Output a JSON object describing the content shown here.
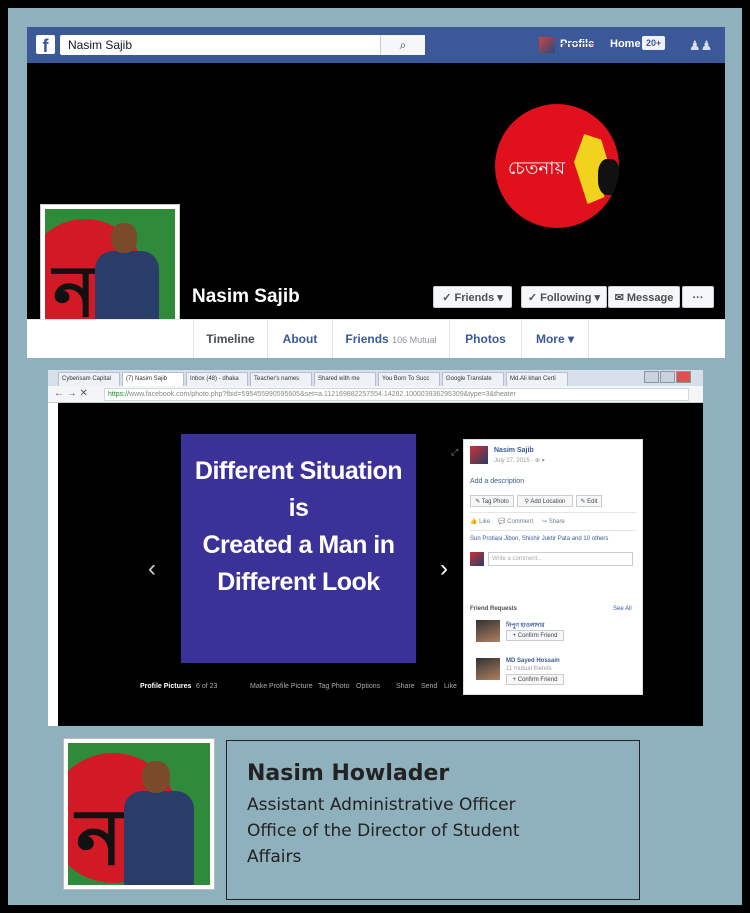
{
  "fb_header": {
    "logo": "f",
    "search_value": "Nasim Sajib",
    "search_icon": "search-icon",
    "user_name": "Profile",
    "home_label": "Home",
    "home_badge": "20+"
  },
  "cover": {
    "logo_text": "চেতনায়"
  },
  "profile": {
    "name": "Nasim Sajib",
    "friends_button": "✓ Friends ▾",
    "following_button": "✓ Following ▾",
    "message_button": "✉ Message",
    "more_button": "···"
  },
  "tabs": {
    "timeline": "Timeline",
    "about": "About",
    "friends": "Friends",
    "friends_mutual": "106 Mutual",
    "photos": "Photos",
    "more": "More ▾"
  },
  "browser": {
    "tabs": [
      "Cyberisam Capital",
      "(7) Nasim Sajib",
      "Inbox (48) - dhaka",
      "Teacher's names",
      "Shared with me",
      "You Born To Succ",
      "Google Translate",
      "Md.Ali khan Certi"
    ],
    "url_https": "https://",
    "url_rest": "www.facebook.com/photo.php?fbid=595455990595605&set=a.112169882257554.14282.100003936295309&type=3&theater"
  },
  "photo": {
    "lines": [
      "Different Situation",
      "is",
      "Created a Man in",
      "Different Look"
    ]
  },
  "theater_bar": {
    "album": "Profile Pictures",
    "count": "6 of 23",
    "make_profile": "Make Profile Picture",
    "tag_photo": "Tag Photo",
    "options": "Options",
    "share": "Share",
    "send": "Send",
    "like": "Like"
  },
  "side_panel": {
    "name": "Nasim Sajib",
    "date": "July 27, 2015 · ⊕ ▾",
    "add_description": "Add a description",
    "tag_photo": "✎ Tag Photo",
    "add_location": "⚲ Add Location",
    "edit": "✎ Edit",
    "like": "👍 Like",
    "comment": "💬 Comment",
    "share": "↪ Share",
    "likers": "Sun Protiasi Jibon, Shishir Juktir Pata and 10 others",
    "comment_placeholder": "Write a comment...",
    "friend_requests": "Friend Requests",
    "see_all": "See All",
    "req1_name": "নিপুণ হাওলাদার",
    "req1_button": "+ Confirm Friend",
    "req2_name": "MD Sayed Hossain",
    "req2_mutual": "11 mutual friends",
    "req2_button": "+ Confirm Friend"
  },
  "card": {
    "name": "Nasim Howlader",
    "title": "Assistant Administrative Officer",
    "office_line1": "Office of the Director of Student",
    "office_line2": "Affairs"
  },
  "colors": {
    "frame": "#8fb0bd",
    "facebook_blue": "#3b5998",
    "photo_bg": "#3b3299",
    "cover_red": "#e0101d"
  }
}
